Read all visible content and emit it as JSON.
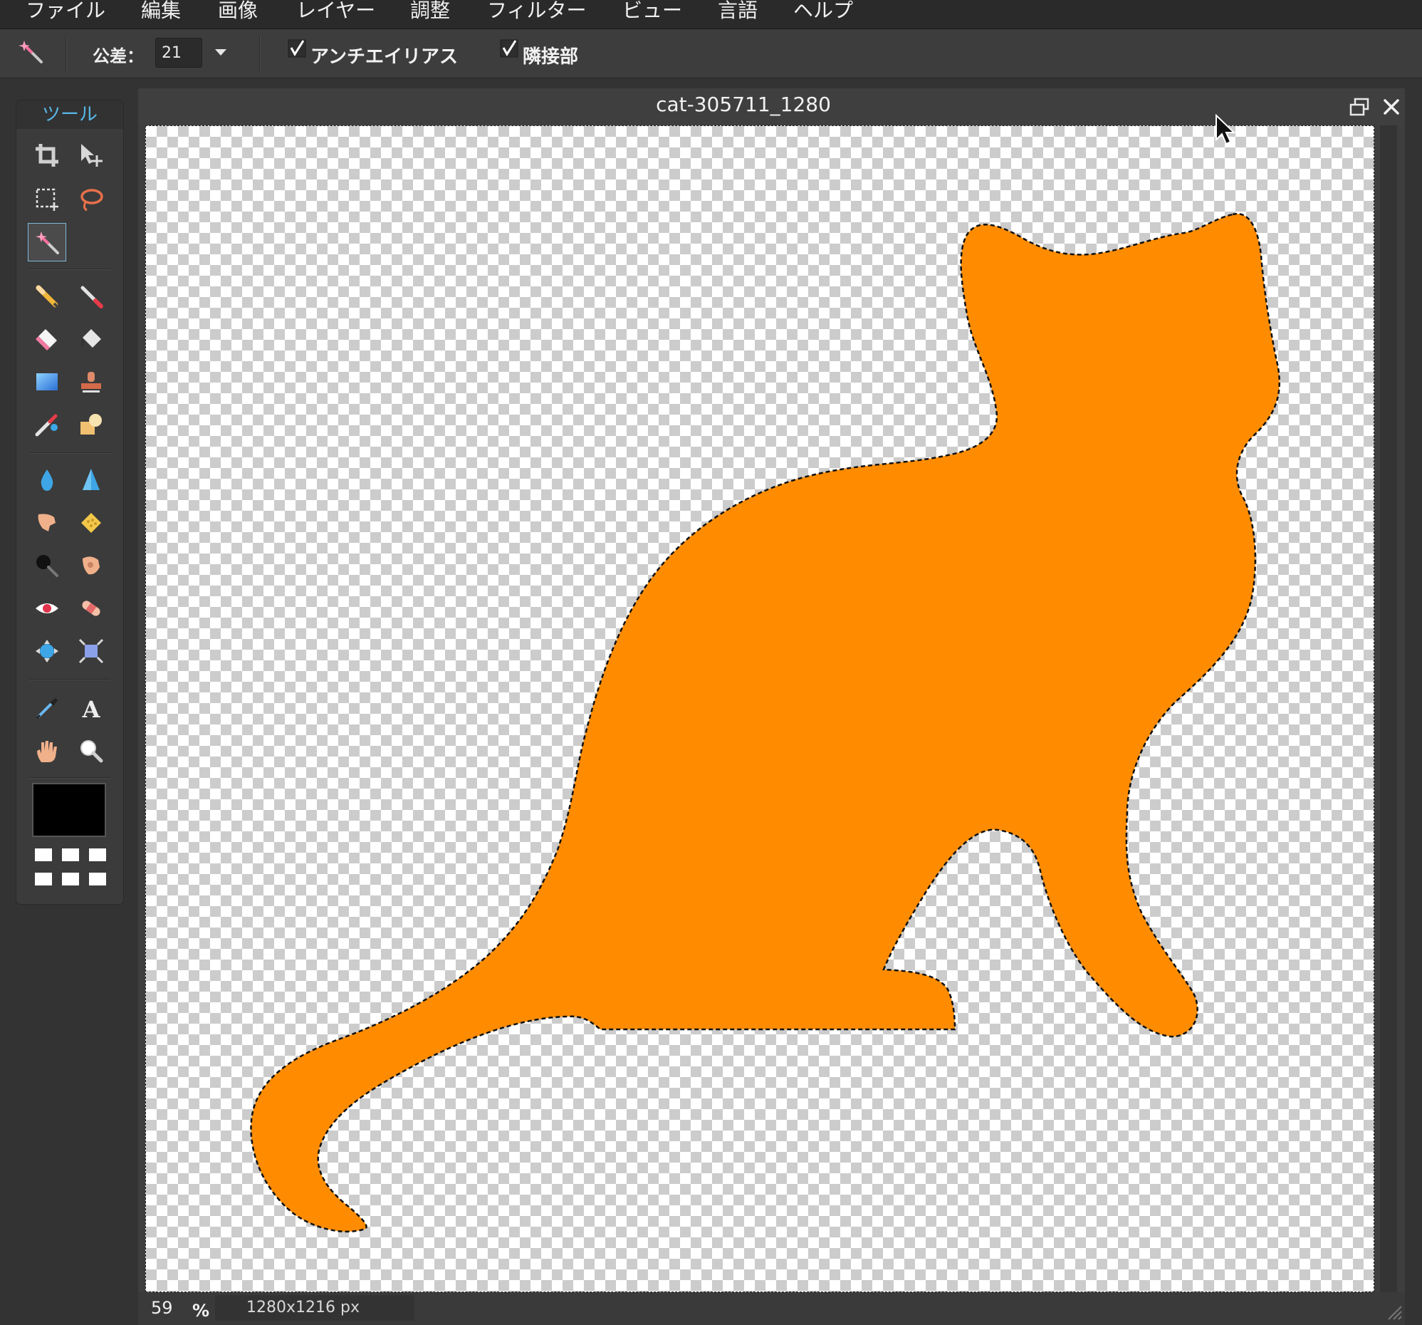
{
  "menu": {
    "items": [
      {
        "id": "file",
        "label": "ファイル"
      },
      {
        "id": "edit",
        "label": "編集"
      },
      {
        "id": "image",
        "label": "画像"
      },
      {
        "id": "layer",
        "label": "レイヤー"
      },
      {
        "id": "adjust",
        "label": "調整"
      },
      {
        "id": "filter",
        "label": "フィルター"
      },
      {
        "id": "view",
        "label": "ビュー"
      },
      {
        "id": "language",
        "label": "言語"
      },
      {
        "id": "help",
        "label": "ヘルプ"
      }
    ]
  },
  "options": {
    "tool_icon": "magic-wand-icon",
    "tolerance_label": "公差：",
    "tolerance_value": "21",
    "antialias_label": "アンチエイリアス",
    "antialias_checked": true,
    "contiguous_label": "隣接部",
    "contiguous_checked": true
  },
  "tools": {
    "title": "ツール",
    "active": "magic-wand",
    "items": [
      "crop",
      "move",
      "marquee",
      "lasso",
      "magic-wand",
      "pencil",
      "brush",
      "eraser",
      "paint-bucket",
      "gradient",
      "clone-stamp",
      "color-replace",
      "shape",
      "blur",
      "sharpen",
      "smudge",
      "sponge",
      "burn",
      "dodge",
      "red-eye",
      "spot-heal",
      "bloat",
      "pinch",
      "color-picker",
      "type",
      "hand",
      "zoom"
    ],
    "foreground_color": "#000000"
  },
  "document": {
    "title": "cat-305711_1280",
    "zoom": "59",
    "zoom_unit": "%",
    "size": "1280x1216 px",
    "fill_color": "#FF8C00"
  }
}
